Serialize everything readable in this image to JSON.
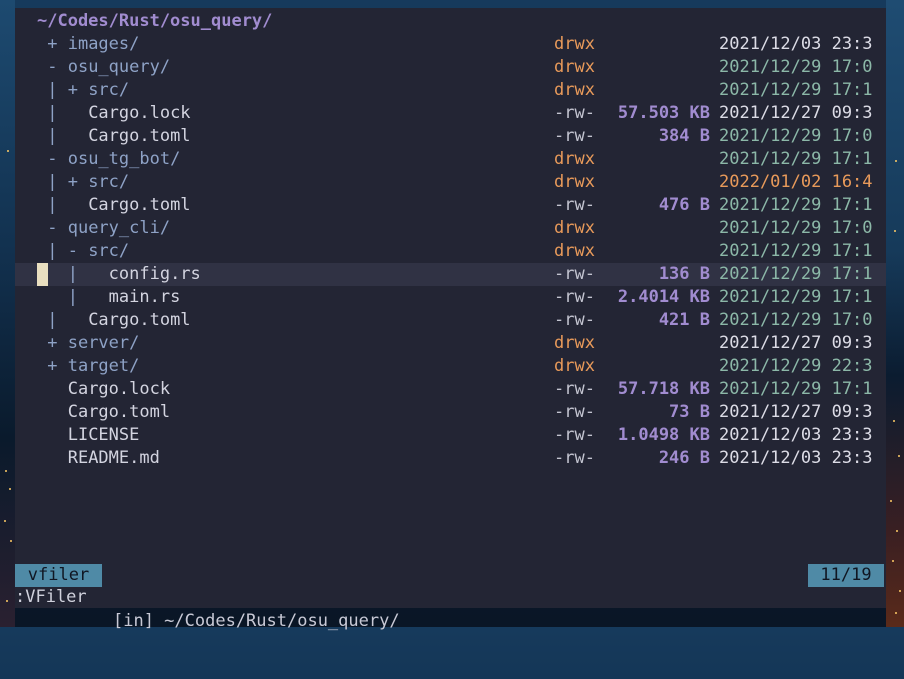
{
  "header": {
    "path": "~/Codes/Rust/osu_query/"
  },
  "rows": [
    {
      "prefix": "+ ",
      "name": "images/",
      "kind": "dir",
      "perm": "drwx",
      "size": "",
      "date": "2021/12/03 23:3",
      "date_color": "white"
    },
    {
      "prefix": "- ",
      "name": "osu_query/",
      "kind": "dir",
      "perm": "drwx",
      "size": "",
      "date": "2021/12/29 17:0",
      "date_color": "teal"
    },
    {
      "prefix": "| + ",
      "name": "src/",
      "kind": "dir",
      "perm": "drwx",
      "size": "",
      "date": "2021/12/29 17:1",
      "date_color": "teal"
    },
    {
      "prefix": "|   ",
      "name": "Cargo.lock",
      "kind": "file",
      "perm": "-rw-",
      "size": "57.503 KB",
      "date": "2021/12/27 09:3",
      "date_color": "white"
    },
    {
      "prefix": "|   ",
      "name": "Cargo.toml",
      "kind": "file",
      "perm": "-rw-",
      "size": "384 B",
      "date": "2021/12/29 17:0",
      "date_color": "teal"
    },
    {
      "prefix": "- ",
      "name": "osu_tg_bot/",
      "kind": "dir",
      "perm": "drwx",
      "size": "",
      "date": "2021/12/29 17:1",
      "date_color": "teal"
    },
    {
      "prefix": "| + ",
      "name": "src/",
      "kind": "dir",
      "perm": "drwx",
      "size": "",
      "date": "2022/01/02 16:4",
      "date_color": "orange"
    },
    {
      "prefix": "|   ",
      "name": "Cargo.toml",
      "kind": "file",
      "perm": "-rw-",
      "size": "476 B",
      "date": "2021/12/29 17:1",
      "date_color": "teal"
    },
    {
      "prefix": "- ",
      "name": "query_cli/",
      "kind": "dir",
      "perm": "drwx",
      "size": "",
      "date": "2021/12/29 17:0",
      "date_color": "teal"
    },
    {
      "prefix": "| - ",
      "name": "src/",
      "kind": "dir",
      "perm": "drwx",
      "size": "",
      "date": "2021/12/29 17:1",
      "date_color": "teal"
    },
    {
      "prefix": "  |   ",
      "name": "config.rs",
      "kind": "file",
      "perm": "-rw-",
      "size": "136 B",
      "date": "2021/12/29 17:1",
      "date_color": "teal",
      "selected": true
    },
    {
      "prefix": "  |   ",
      "name": "main.rs",
      "kind": "file",
      "perm": "-rw-",
      "size": "2.4014 KB",
      "date": "2021/12/29 17:1",
      "date_color": "teal"
    },
    {
      "prefix": "|   ",
      "name": "Cargo.toml",
      "kind": "file",
      "perm": "-rw-",
      "size": "421 B",
      "date": "2021/12/29 17:0",
      "date_color": "teal"
    },
    {
      "prefix": "+ ",
      "name": "server/",
      "kind": "dir",
      "perm": "drwx",
      "size": "",
      "date": "2021/12/27 09:3",
      "date_color": "white"
    },
    {
      "prefix": "+ ",
      "name": "target/",
      "kind": "dir",
      "perm": "drwx",
      "size": "",
      "date": "2021/12/29 22:3",
      "date_color": "teal"
    },
    {
      "prefix": "  ",
      "name": "Cargo.lock",
      "kind": "file",
      "perm": "-rw-",
      "size": "57.718 KB",
      "date": "2021/12/29 17:1",
      "date_color": "teal"
    },
    {
      "prefix": "  ",
      "name": "Cargo.toml",
      "kind": "file",
      "perm": "-rw-",
      "size": "73 B",
      "date": "2021/12/27 09:3",
      "date_color": "white"
    },
    {
      "prefix": "  ",
      "name": "LICENSE",
      "kind": "file",
      "perm": "-rw-",
      "size": "1.0498 KB",
      "date": "2021/12/03 23:3",
      "date_color": "white"
    },
    {
      "prefix": "  ",
      "name": "README.md",
      "kind": "file",
      "perm": "-rw-",
      "size": "246 B",
      "date": "2021/12/03 23:3",
      "date_color": "white"
    }
  ],
  "statusline": {
    "mode": "vfiler",
    "path": "[in] ~/Codes/Rust/osu_query/",
    "position": "11/19"
  },
  "cmdline": {
    "text": ":VFiler"
  },
  "colors": {
    "background": "#232534",
    "header": "#a18cd0",
    "dir_perm": "#e89a5a",
    "size": "#a18cd0",
    "date_teal": "#8cb8a8",
    "date_orange": "#e89a5a",
    "badge": "#4f8aa6"
  }
}
